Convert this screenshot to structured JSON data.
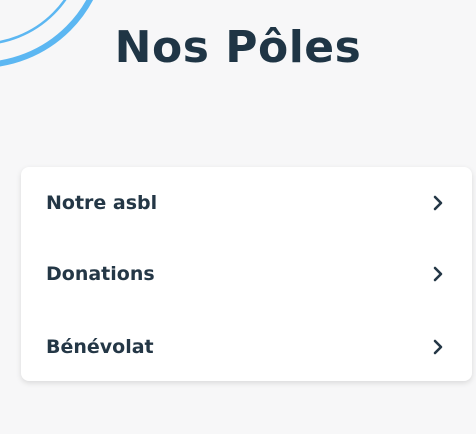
{
  "colors": {
    "accent": "#5cb7f2",
    "text": "#243746",
    "background": "#f7f7f8",
    "card": "#ffffff"
  },
  "page": {
    "title": "Nos Pôles"
  },
  "menu": {
    "items": [
      {
        "label": "Notre asbl",
        "icon": "chevron-right-icon"
      },
      {
        "label": "Donations",
        "icon": "chevron-right-icon"
      },
      {
        "label": "Bénévolat",
        "icon": "chevron-right-icon"
      }
    ]
  }
}
